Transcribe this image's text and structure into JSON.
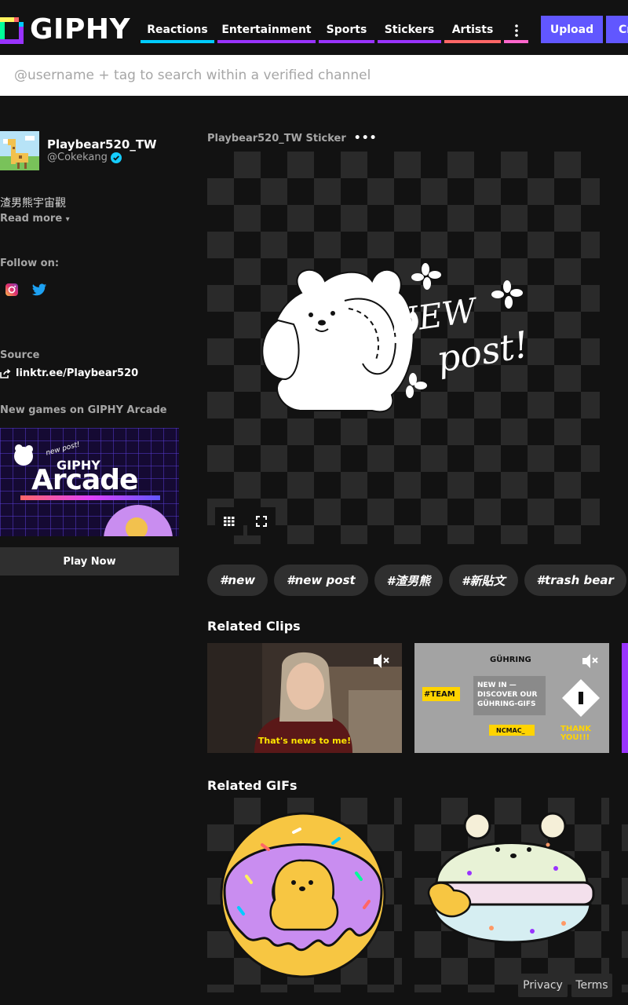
{
  "header": {
    "logo_text": "GIPHY",
    "nav": [
      {
        "label": "Reactions",
        "color": "#00ccff"
      },
      {
        "label": "Entertainment",
        "color": "#9933ff"
      },
      {
        "label": "Sports",
        "color": "#9933ff"
      },
      {
        "label": "Stickers",
        "color": "#9933ff"
      },
      {
        "label": "Artists",
        "color": "#ff6666"
      }
    ],
    "more_icon": "vertical-dots-icon",
    "upload_label": "Upload",
    "create_label": "Create",
    "accent": "#6157ff"
  },
  "search": {
    "placeholder": "@username + tag to search within a verified channel"
  },
  "sidebar": {
    "channel_name": "Playbear520_TW",
    "channel_user": "@Cokekang",
    "bio": "渣男熊宇宙觀",
    "read_more": "Read more",
    "follow_label": "Follow on:",
    "social": [
      "instagram-icon",
      "twitter-icon"
    ],
    "source_label": "Source",
    "source_link": "linktr.ee/Playbear520",
    "arcade_label": "New games on GIPHY Arcade",
    "arcade_banner_top": "GIPHY",
    "arcade_banner_main": "Arcade",
    "arcade_mini_text": "new post!",
    "play_now": "Play Now"
  },
  "main": {
    "sticker_title": "Playbear520_TW Sticker",
    "sticker_text_1": "NEW",
    "sticker_text_2": "post!",
    "tags": [
      "#new",
      "#new post",
      "#渣男熊",
      "#新貼文",
      "#trash bear"
    ],
    "related_clips_title": "Related Clips",
    "clip_1_caption": "That's news to me!",
    "clip_2_logo": "GÜHRING",
    "clip_2_text": "NEW IN — DISCOVER OUR GÜHRING-GIFS",
    "clip_2_team": "#TEAM",
    "clip_2_ncmac": "NCMAC_",
    "clip_2_thanks": "THANK YOU!!!",
    "related_gifs_title": "Related GIFs"
  },
  "footer": {
    "privacy": "Privacy",
    "terms": "Terms"
  }
}
